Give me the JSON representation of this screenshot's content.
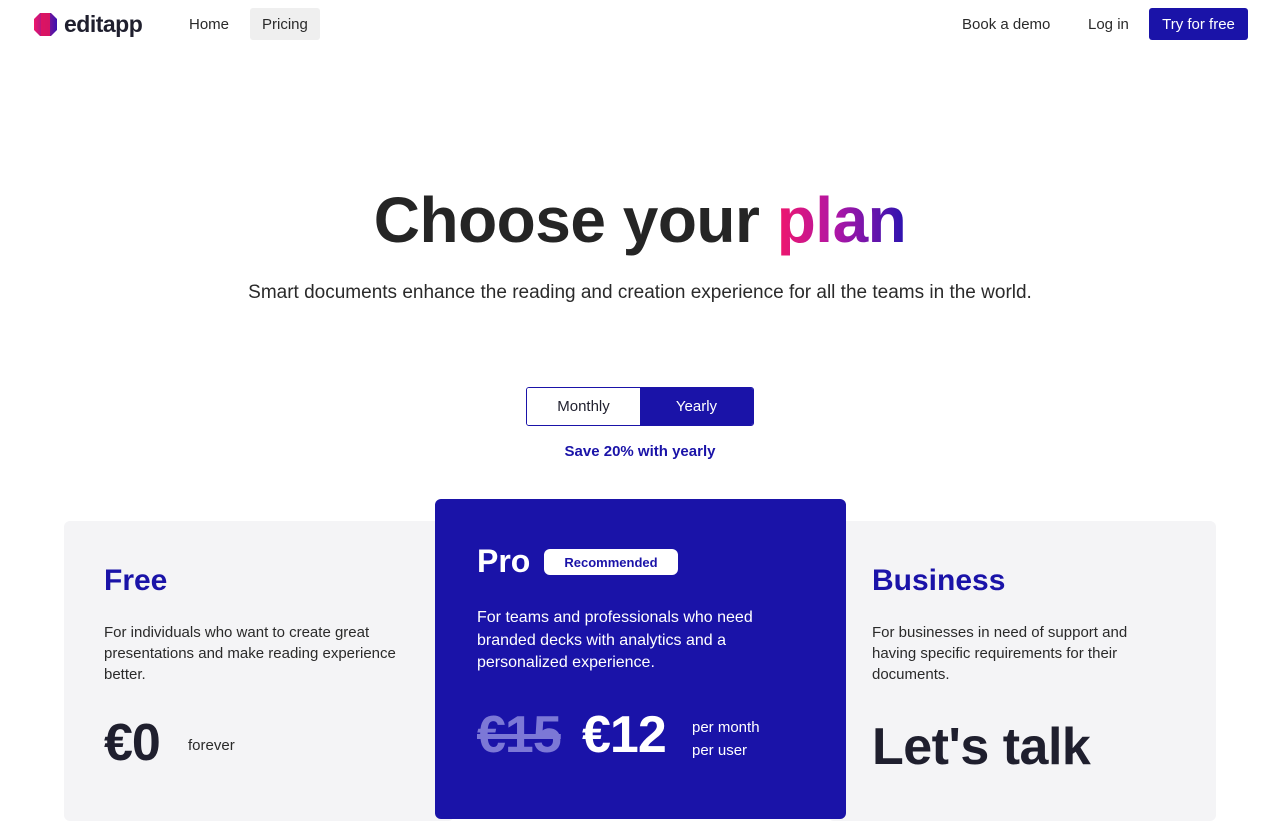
{
  "brand": {
    "name": "editapp"
  },
  "nav": {
    "home": "Home",
    "pricing": "Pricing",
    "book_demo": "Book a demo",
    "login": "Log in",
    "try_free": "Try for free"
  },
  "hero": {
    "title_main": "Choose your ",
    "title_accent": "plan",
    "subtitle": "Smart documents enhance the reading and creation experience for all the teams in the world."
  },
  "billing": {
    "monthly": "Monthly",
    "yearly": "Yearly",
    "selected": "yearly",
    "save_note": "Save 20% with yearly"
  },
  "plans": {
    "free": {
      "name": "Free",
      "description": "For individuals who want to create great presentations and make reading experience better.",
      "price": "€0",
      "unit": "forever"
    },
    "pro": {
      "name": "Pro",
      "badge": "Recommended",
      "description": "For teams and professionals who need branded decks with analytics and a personalized experience.",
      "old_price": "€15",
      "price": "€12",
      "unit_line1": "per month",
      "unit_line2": "per user"
    },
    "business": {
      "name": "Business",
      "description": "For businesses in need of support and having specific requirements for their documents.",
      "price": "Let's talk"
    }
  },
  "colors": {
    "brand_primary": "#1a13a8",
    "accent_pink": "#f0176b",
    "card_gray": "#f4f4f6"
  }
}
